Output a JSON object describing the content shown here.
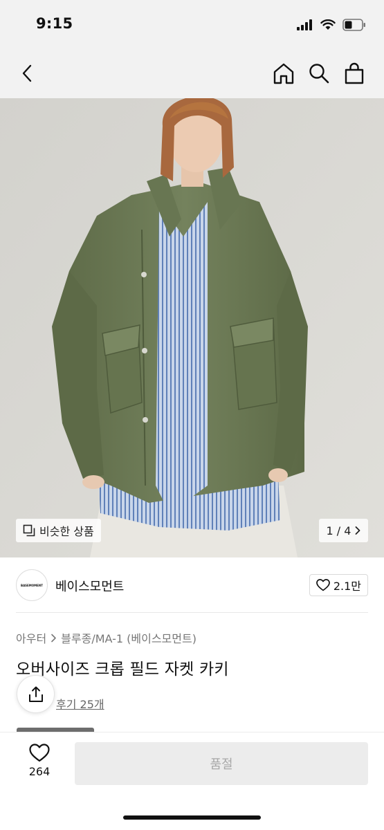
{
  "status_bar": {
    "time": "9:15"
  },
  "nav": {
    "back_icon": "chevron-left-icon",
    "home_icon": "home-icon",
    "search_icon": "search-icon",
    "cart_icon": "shopping-bag-icon"
  },
  "hero": {
    "similar_label": "비슷한 상품",
    "pager_text": "1 / 4"
  },
  "brand": {
    "logo_text": "BASEMOMENT",
    "name": "베이스모먼트",
    "likes": "2.1만"
  },
  "product": {
    "breadcrumb": [
      "아우터",
      "블루종/MA-1 (베이스모먼트)"
    ],
    "title": "오버사이즈 크롭 필드 자켓 카키",
    "review_text": "후기 25개"
  },
  "bottom": {
    "like_count": "264",
    "buy_label": "품절"
  },
  "colors": {
    "chrome_bg": "#f2f2f2",
    "sold_out_bg": "#ececec",
    "sold_out_text": "#a8a8a8",
    "jacket": "#6f7d58"
  }
}
